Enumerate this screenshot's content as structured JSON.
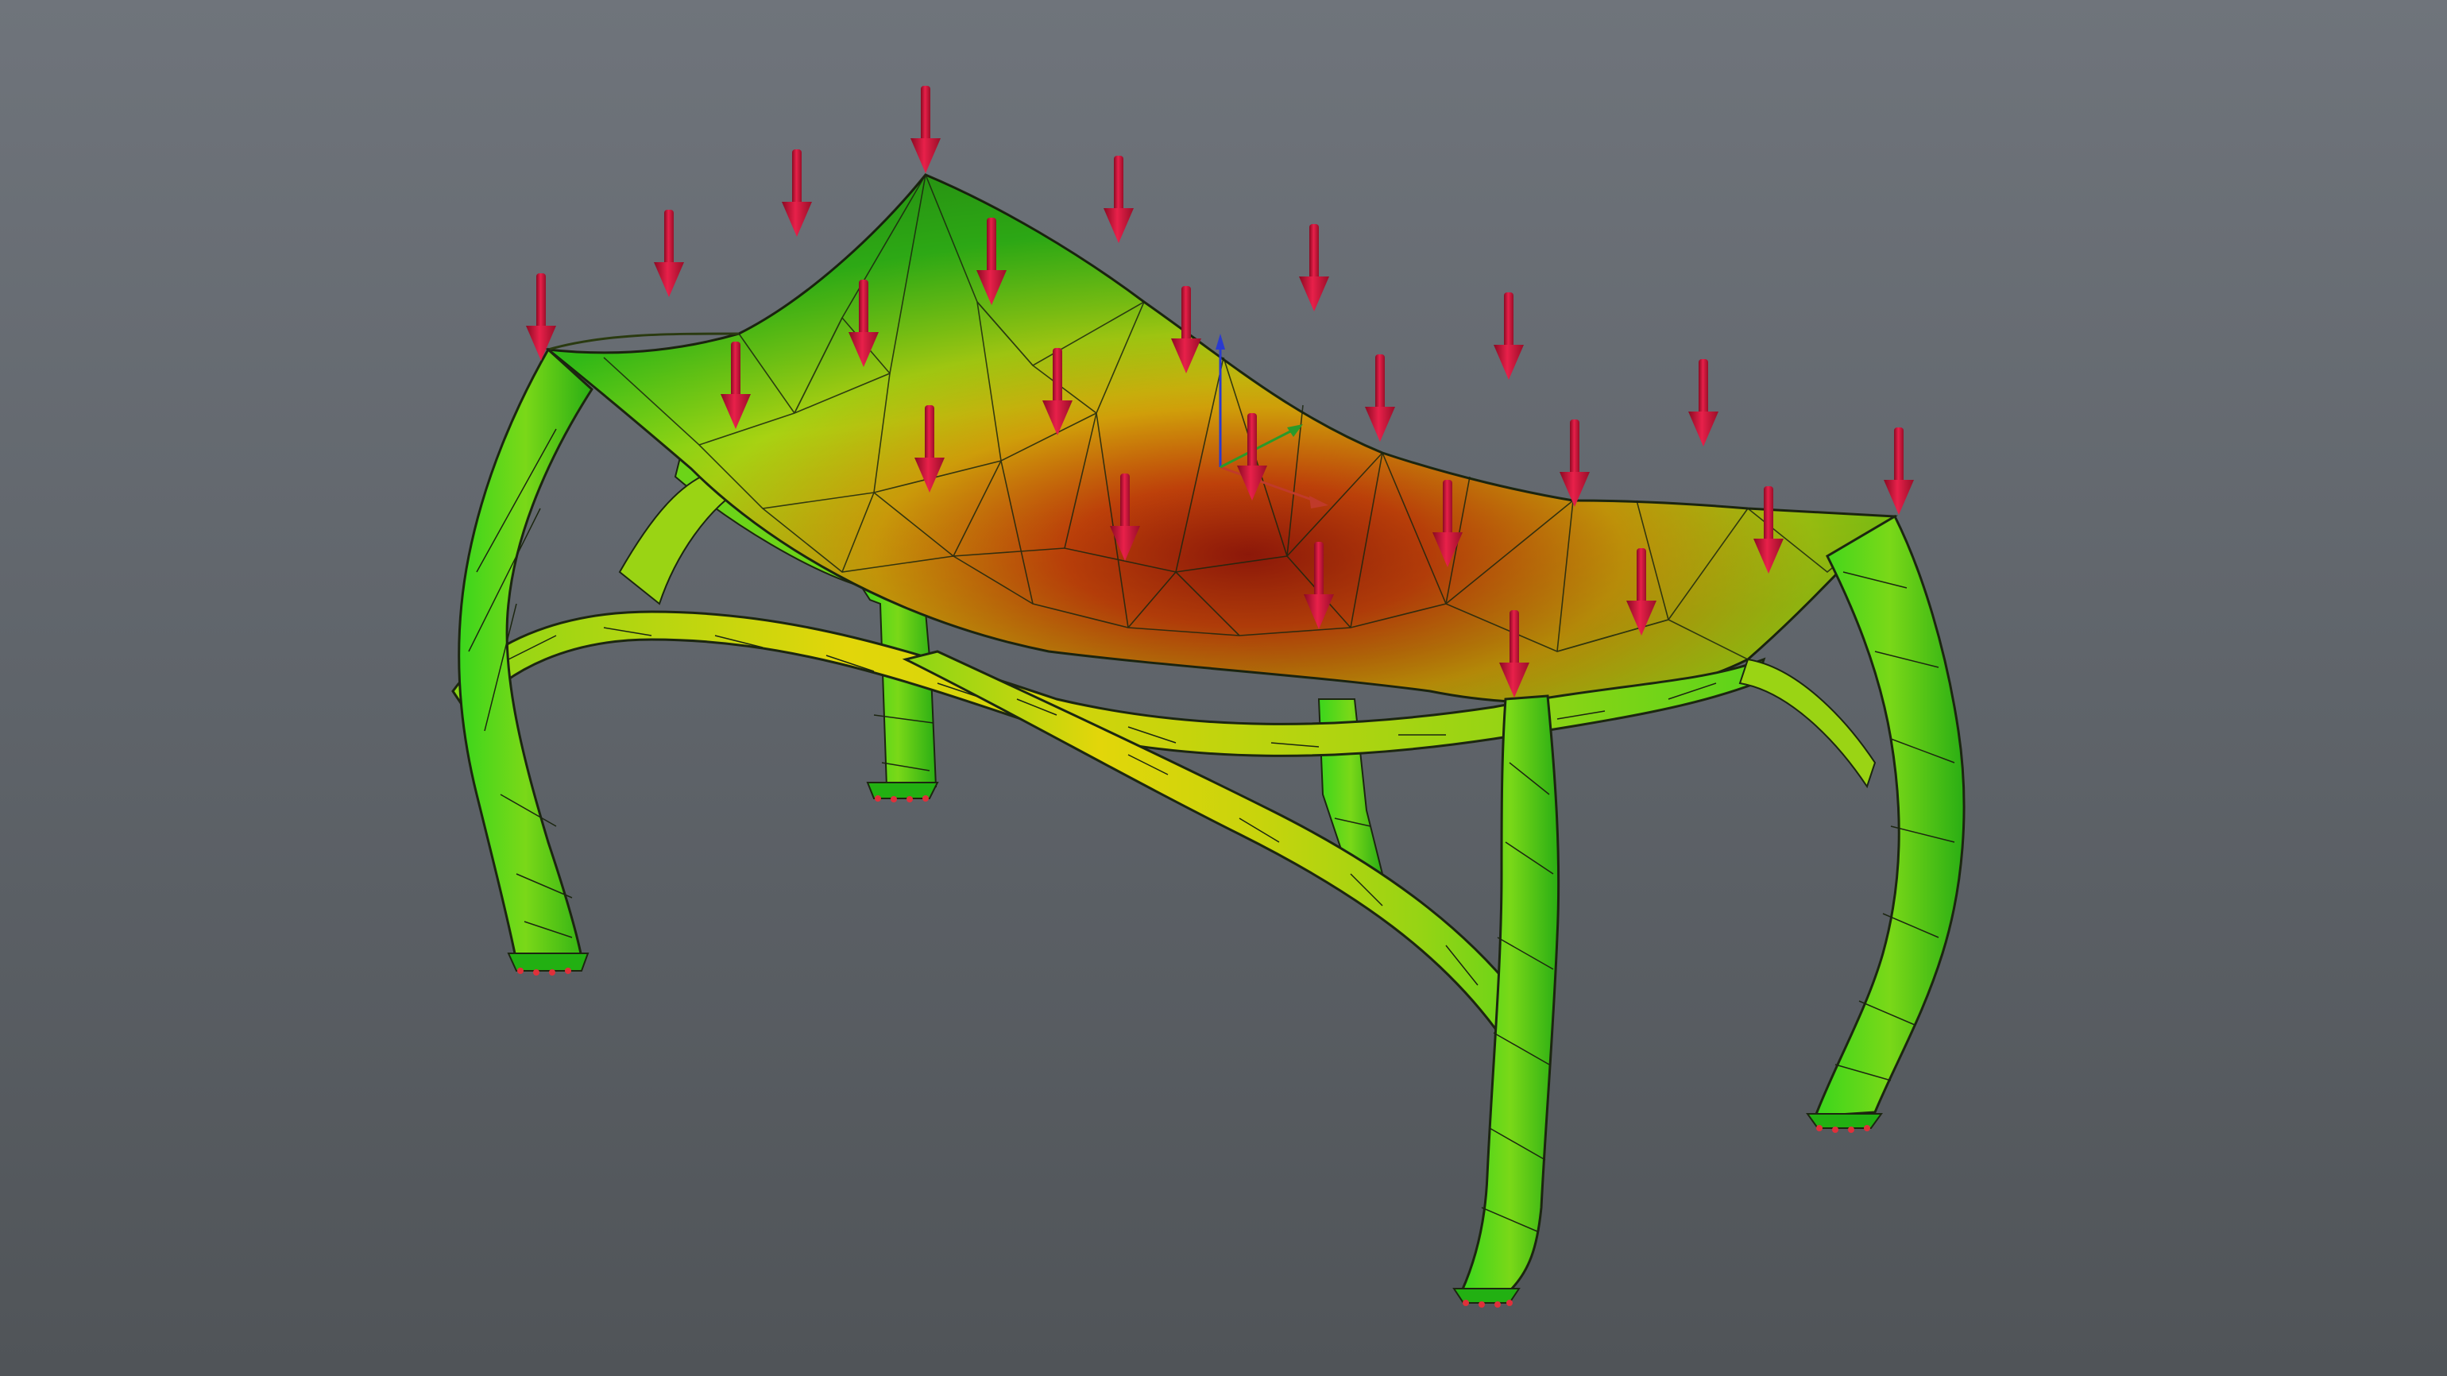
{
  "viewport": {
    "background_top": "#6f747b",
    "background_bottom": "#505458"
  },
  "model": {
    "name": "",
    "kind": "fea-deformation-result",
    "colormap": [
      "#2fd21e",
      "#9ad614",
      "#e6d20a",
      "#d2780a",
      "#9a1a0a"
    ],
    "load_arrow_color": "#d01838",
    "load_arrow_count": 24,
    "support_count": 4,
    "support_marker_color": "#e0303a",
    "mesh_line_color": "#1c2610"
  },
  "axis_triad": {
    "x_color": "#c03a2a",
    "y_color": "#2a9a2a",
    "z_color": "#2a3ad0"
  }
}
